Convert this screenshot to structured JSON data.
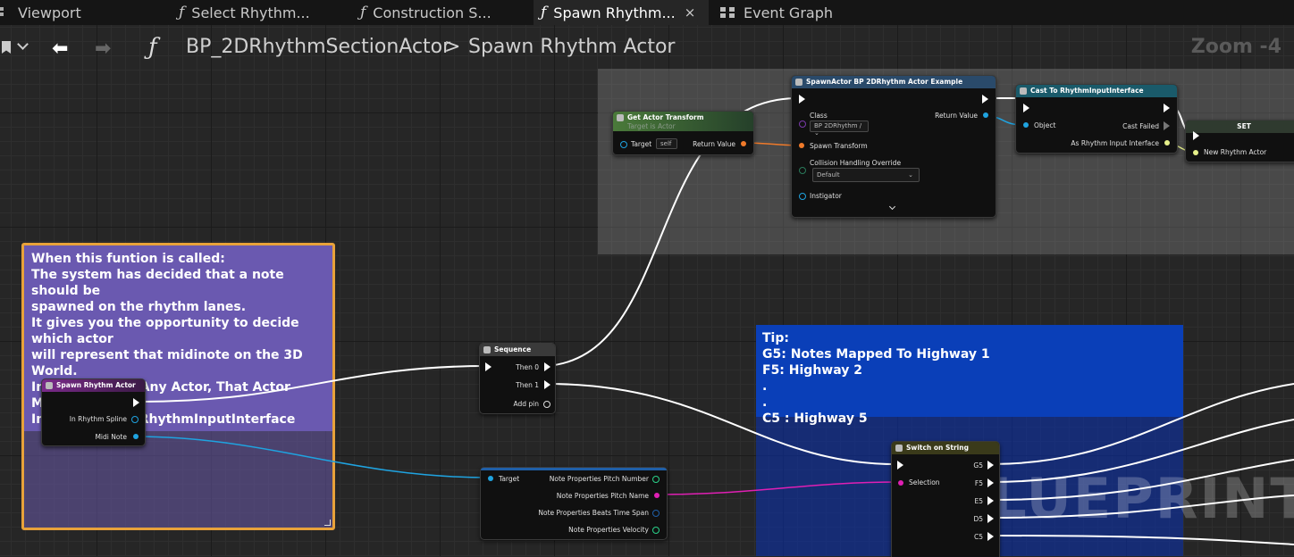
{
  "tabs": [
    {
      "label": "Viewport",
      "icon": "viewport-icon",
      "active": false
    },
    {
      "label": "Select Rhythm...",
      "icon": "function-icon",
      "active": false
    },
    {
      "label": "Construction S...",
      "icon": "function-icon",
      "active": false
    },
    {
      "label": "Spawn Rhythm...",
      "icon": "function-icon",
      "active": true
    },
    {
      "label": "Event Graph",
      "icon": "event-graph-icon",
      "active": false
    }
  ],
  "tab_close_glyph": "×",
  "breadcrumb": {
    "blueprint": "BP_2DRhythmSectionActor",
    "separator": ">",
    "function": "Spawn Rhythm Actor",
    "zoom": "Zoom -4"
  },
  "comments": {
    "left": {
      "lines": [
        "When this funtion is called:",
        "The system has decided that a note should be",
        "spawned on the rhythm lanes.",
        "It gives you the opportunity to decide which actor",
        "will represent that midinote on the 3D World.",
        "In order to use Any Actor, That Actor MUST",
        "Implement the RhythmInputInterface"
      ]
    },
    "right": {
      "lines": [
        "Tip:",
        "G5: Notes Mapped To Highway 1",
        "F5: Highway 2",
        ".",
        ".",
        "C5 : Highway 5"
      ]
    },
    "watermark": "BLUEPRINT"
  },
  "nodes": {
    "entry": {
      "title": "Spawn Rhythm Actor",
      "pins": [
        "In Rhythm Spline",
        "Midi Note"
      ]
    },
    "sequence": {
      "title": "Sequence",
      "pins": [
        "Then 0",
        "Then 1",
        "Add pin"
      ]
    },
    "get_transform": {
      "title": "Get Actor Transform",
      "subtitle": "Target is Actor",
      "target_label": "Target",
      "target_value": "self",
      "return": "Return Value"
    },
    "spawn_actor": {
      "title": "SpawnActor BP 2DRhythm Actor Example",
      "class_label": "Class",
      "class_value": "BP 2DRhythm /",
      "return": "Return Value",
      "spawn_transform": "Spawn Transform",
      "collision_label": "Collision Handling Override",
      "collision_value": "Default",
      "instigator": "Instigator"
    },
    "cast": {
      "title": "Cast To RhythmInputInterface",
      "object": "Object",
      "cast_failed": "Cast Failed",
      "as_interface": "As Rhythm Input Interface"
    },
    "set": {
      "title": "SET",
      "pin": "New Rhythm Actor"
    },
    "break_note": {
      "target": "Target",
      "pins": [
        "Note Properties Pitch Number",
        "Note Properties Pitch Name",
        "Note Properties Beats Time Span",
        "Note Properties Velocity"
      ]
    },
    "switch": {
      "title": "Switch on String",
      "selection": "Selection",
      "cases": [
        "G5",
        "F5",
        "E5",
        "D5",
        "C5"
      ]
    }
  },
  "colors": {
    "exec": "#ffffff",
    "object_pin": "#1fa3e0",
    "transform_pin": "#f07a2a",
    "string_pin": "#e01fb4",
    "struct_pin": "#3c8a3c",
    "comment_border": "#e8a23a"
  }
}
